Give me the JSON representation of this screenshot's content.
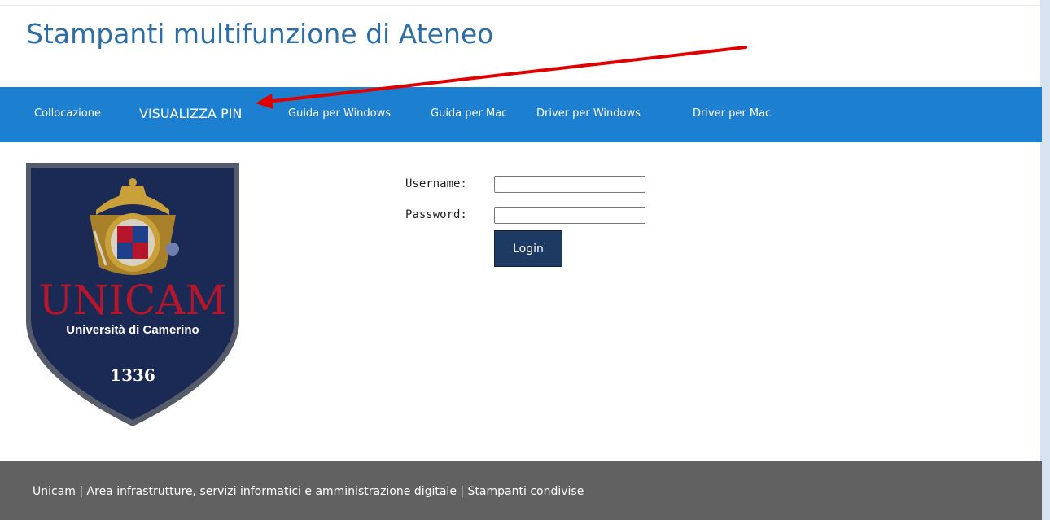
{
  "header": {
    "title": "Stampanti multifunzione di Ateneo"
  },
  "nav": {
    "items": [
      {
        "label": "Collocazione"
      },
      {
        "label": "VISUALIZZA PIN"
      },
      {
        "label": "Guida per Windows"
      },
      {
        "label": "Guida per Mac"
      },
      {
        "label": "Driver per Windows"
      },
      {
        "label": "Driver per Mac"
      }
    ]
  },
  "logo": {
    "name": "UNICAM",
    "subtitle": "Università di Camerino",
    "year": "1336"
  },
  "login": {
    "username_label": "Username:",
    "username_value": "",
    "password_label": "Password:",
    "password_value": "",
    "button_label": "Login"
  },
  "footer": {
    "text": "Unicam | Area infrastrutture, servizi informatici e amministrazione digitale | Stampanti condivise"
  },
  "colors": {
    "nav_bg": "#1d7fcf",
    "title": "#2e6ea7",
    "footer_bg": "#616161",
    "button_bg": "#1d3a63",
    "logo_shield": "#1b2a55",
    "logo_red": "#b5162b",
    "annotation_arrow": "#e00000"
  }
}
